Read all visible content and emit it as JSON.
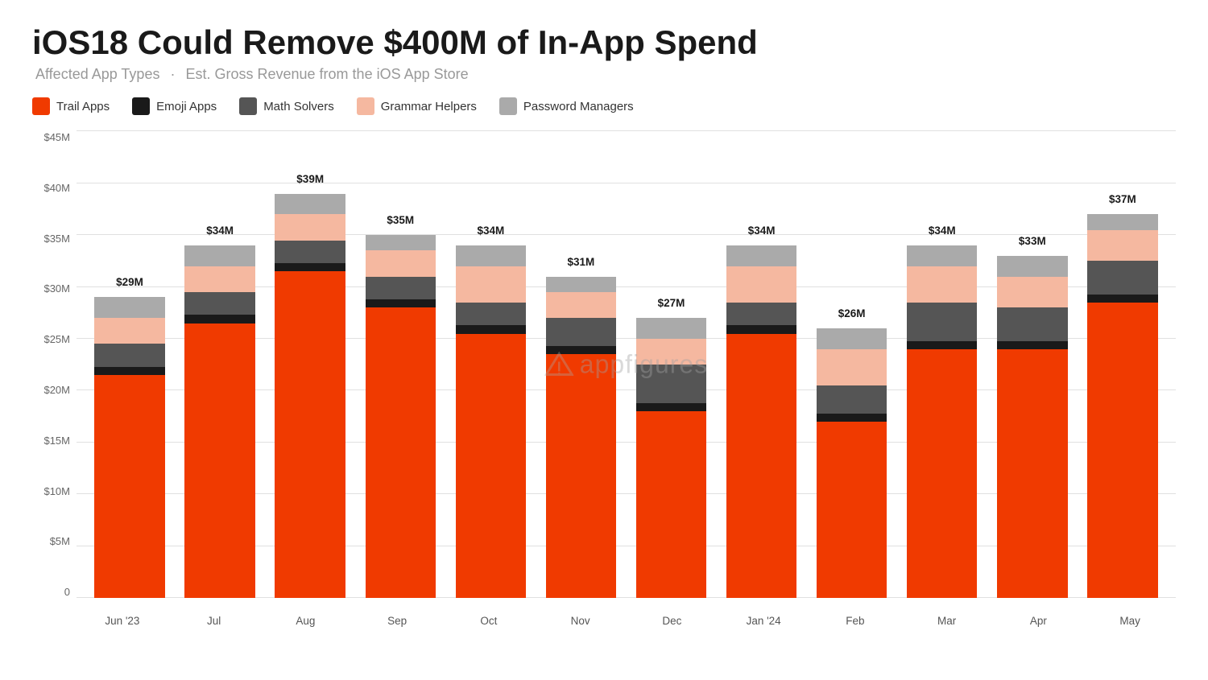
{
  "title": "iOS18 Could Remove $400M of In-App Spend",
  "subtitle_main": "Affected App Types",
  "subtitle_sep": "·",
  "subtitle_desc": "Est. Gross Revenue from the iOS App Store",
  "legend": [
    {
      "label": "Trail Apps",
      "color": "#F03A00",
      "id": "trail"
    },
    {
      "label": "Emoji Apps",
      "color": "#1a1a1a",
      "id": "emoji"
    },
    {
      "label": "Math Solvers",
      "color": "#555555",
      "id": "math"
    },
    {
      "label": "Grammar Helpers",
      "color": "#F5B8A0",
      "id": "grammar"
    },
    {
      "label": "Password Managers",
      "color": "#AAAAAA",
      "id": "password"
    }
  ],
  "y_labels": [
    "0",
    "$5M",
    "$10M",
    "$15M",
    "$20M",
    "$25M",
    "$30M",
    "$35M",
    "$40M",
    "$45M"
  ],
  "max_value": 45,
  "bars": [
    {
      "month": "Jun '23",
      "total_label": "$29M",
      "segments": {
        "trail": 21.5,
        "emoji": 0.8,
        "math": 2.2,
        "grammar": 2.5,
        "password": 2.0
      }
    },
    {
      "month": "Jul",
      "total_label": "$34M",
      "segments": {
        "trail": 26.5,
        "emoji": 0.8,
        "math": 2.2,
        "grammar": 2.5,
        "password": 2.0
      }
    },
    {
      "month": "Aug",
      "total_label": "$39M",
      "segments": {
        "trail": 31.5,
        "emoji": 0.8,
        "math": 2.2,
        "grammar": 2.5,
        "password": 2.0
      }
    },
    {
      "month": "Sep",
      "total_label": "$35M",
      "segments": {
        "trail": 28.0,
        "emoji": 0.8,
        "math": 2.2,
        "grammar": 2.5,
        "password": 1.5
      }
    },
    {
      "month": "Oct",
      "total_label": "$34M",
      "segments": {
        "trail": 25.5,
        "emoji": 0.8,
        "math": 2.2,
        "grammar": 3.5,
        "password": 2.0
      }
    },
    {
      "month": "Nov",
      "total_label": "$31M",
      "segments": {
        "trail": 23.5,
        "emoji": 0.8,
        "math": 2.7,
        "grammar": 2.5,
        "password": 1.5
      }
    },
    {
      "month": "Dec",
      "total_label": "$27M",
      "segments": {
        "trail": 18.0,
        "emoji": 0.8,
        "math": 3.7,
        "grammar": 2.5,
        "password": 2.0
      }
    },
    {
      "month": "Jan '24",
      "total_label": "$34M",
      "segments": {
        "trail": 25.5,
        "emoji": 0.8,
        "math": 2.2,
        "grammar": 3.5,
        "password": 2.0
      }
    },
    {
      "month": "Feb",
      "total_label": "$26M",
      "segments": {
        "trail": 17.0,
        "emoji": 0.8,
        "math": 2.7,
        "grammar": 3.5,
        "password": 2.0
      }
    },
    {
      "month": "Mar",
      "total_label": "$34M",
      "segments": {
        "trail": 24.0,
        "emoji": 0.8,
        "math": 3.7,
        "grammar": 3.5,
        "password": 2.0
      }
    },
    {
      "month": "Apr",
      "total_label": "$33M",
      "segments": {
        "trail": 24.0,
        "emoji": 0.8,
        "math": 3.2,
        "grammar": 3.0,
        "password": 2.0
      }
    },
    {
      "month": "May",
      "total_label": "$37M",
      "segments": {
        "trail": 28.5,
        "emoji": 0.8,
        "math": 3.2,
        "grammar": 3.0,
        "password": 1.5
      }
    }
  ],
  "watermark": "appfigures"
}
